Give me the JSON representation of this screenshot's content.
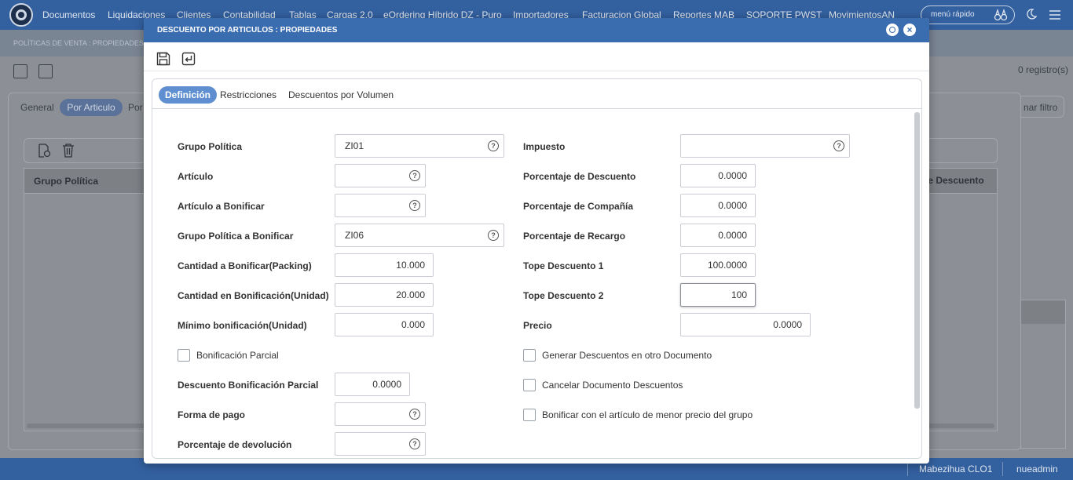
{
  "topnav": {
    "items": [
      "Documentos",
      "Liquidaciones",
      "Clientes",
      "Contabilidad",
      "Tablas",
      "Cargas 2.0",
      "eOrdering Híbrido DZ - Puro",
      "Importadores",
      "Facturacion Global",
      "Reportes MAB",
      "SOPORTE PWST",
      "MovimientosAN"
    ],
    "quick_menu": "menú rápido"
  },
  "background": {
    "subtitle": "POLÍTICAS DE VENTA : PROPIEDADES",
    "record_count": "0 registro(s)",
    "tabs": [
      "General",
      "Por Articulo",
      "Por"
    ],
    "filter_label": "nar filtro",
    "grid_columns": [
      "Grupo Política",
      "je Descuento"
    ]
  },
  "modal": {
    "title": "DESCUENTO POR ARTICULOS : PROPIEDADES",
    "tabs": [
      "Definición",
      "Restricciones",
      "Descuentos por Volumen"
    ],
    "help_glyph": "?",
    "close_glyph": "×",
    "left_fields": [
      {
        "label": "Grupo Política",
        "value": "ZI01"
      },
      {
        "label": "Artículo",
        "value": ""
      },
      {
        "label": "Artículo a Bonificar",
        "value": ""
      },
      {
        "label": "Grupo Política a Bonificar",
        "value": "ZI06"
      },
      {
        "label": "Cantidad a Bonificar(Packing)",
        "value": "10.000"
      },
      {
        "label": "Cantidad en Bonificación(Unidad)",
        "value": "20.000"
      },
      {
        "label": "Mínimo bonificación(Unidad)",
        "value": "0.000"
      },
      {
        "label": "Bonificación Parcial",
        "checked": false
      },
      {
        "label": "Descuento Bonificación Parcial",
        "value": "0.0000"
      },
      {
        "label": "Forma de pago",
        "value": ""
      },
      {
        "label": "Porcentaje de devolución",
        "value": ""
      }
    ],
    "right_fields": [
      {
        "label": "Impuesto",
        "value": ""
      },
      {
        "label": "Porcentaje de Descuento",
        "value": "0.0000"
      },
      {
        "label": "Porcentaje de Compañía",
        "value": "0.0000"
      },
      {
        "label": "Porcentaje de Recargo",
        "value": "0.0000"
      },
      {
        "label": "Tope Descuento 1",
        "value": "100.0000"
      },
      {
        "label": "Tope Descuento 2",
        "value": "100"
      },
      {
        "label": "Precio",
        "value": "0.0000"
      }
    ],
    "right_checks": [
      {
        "label": "Generar Descuentos en otro Documento",
        "checked": false
      },
      {
        "label": "Cancelar Documento Descuentos",
        "checked": false
      },
      {
        "label": "Bonificar con el artículo de menor precio del grupo",
        "checked": false
      }
    ]
  },
  "status": {
    "user_name": "Mabezihua CLO1",
    "login": "nueadmin"
  }
}
